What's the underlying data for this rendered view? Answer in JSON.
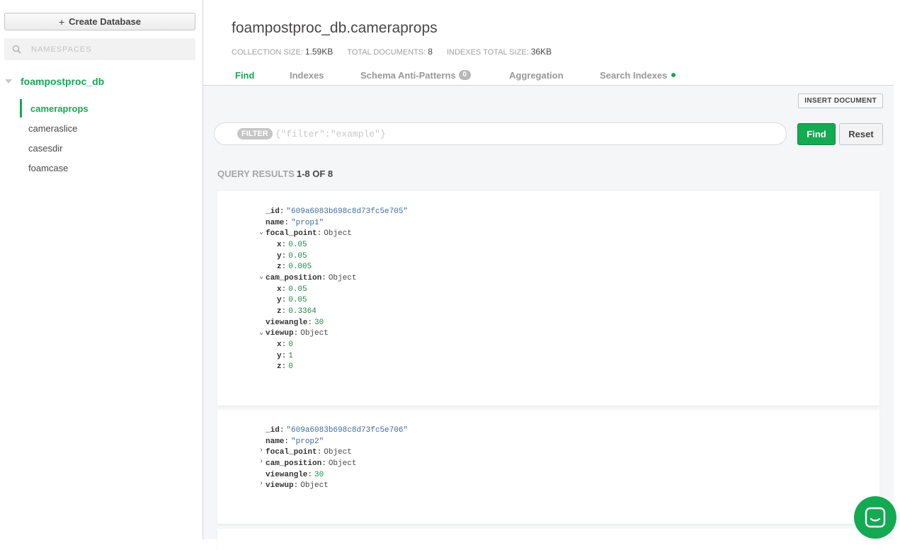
{
  "sidebar": {
    "create_label": "Create Database",
    "search_placeholder": "NAMESPACES",
    "database": "foampostproc_db",
    "collections": [
      "cameraprops",
      "cameraslice",
      "casesdir",
      "foamcase"
    ]
  },
  "header": {
    "title": "foampostproc_db.cameraprops",
    "stats": [
      {
        "label": "COLLECTION SIZE:",
        "value": "1.59KB"
      },
      {
        "label": "TOTAL DOCUMENTS:",
        "value": "8"
      },
      {
        "label": "INDEXES TOTAL SIZE:",
        "value": "36KB"
      }
    ]
  },
  "tabs": {
    "find": "Find",
    "indexes": "Indexes",
    "schema": "Schema Anti-Patterns",
    "schema_badge": "0",
    "aggregation": "Aggregation",
    "search_indexes": "Search Indexes"
  },
  "toolbar": {
    "insert_label": "INSERT DOCUMENT",
    "filter_label": "FILTER",
    "filter_placeholder": "{\"filter\":\"example\"}",
    "find_label": "Find",
    "reset_label": "Reset"
  },
  "results": {
    "label": "QUERY RESULTS",
    "range": "1-8 OF 8"
  },
  "doc1": {
    "id_key": "_id",
    "id_val": "\"609a6083b698c8d73fc5e705\"",
    "name_key": "name",
    "name_val": "\"prop1\"",
    "fp_key": "focal_point",
    "fp_val": "Object",
    "fp_x_key": "x",
    "fp_x": "0.05",
    "fp_y_key": "y",
    "fp_y": "0.05",
    "fp_z_key": "z",
    "fp_z": "0.005",
    "cp_key": "cam_position",
    "cp_val": "Object",
    "cp_x_key": "x",
    "cp_x": "0.05",
    "cp_y_key": "y",
    "cp_y": "0.05",
    "cp_z_key": "z",
    "cp_z": "0.3364",
    "va_key": "viewangle",
    "va_val": "30",
    "vu_key": "viewup",
    "vu_val": "Object",
    "vu_x_key": "x",
    "vu_x": "0",
    "vu_y_key": "y",
    "vu_y": "1",
    "vu_z_key": "z",
    "vu_z": "0"
  },
  "doc2": {
    "id_key": "_id",
    "id_val": "\"609a6083b698c8d73fc5e706\"",
    "name_key": "name",
    "name_val": "\"prop2\"",
    "fp_key": "focal_point",
    "fp_val": "Object",
    "cp_key": "cam_position",
    "cp_val": "Object",
    "va_key": "viewangle",
    "va_val": "30",
    "vu_key": "viewup",
    "vu_val": "Object"
  },
  "colors": {
    "accent": "#13aa52",
    "string": "#3a6ea5",
    "number": "#1c8a48"
  }
}
